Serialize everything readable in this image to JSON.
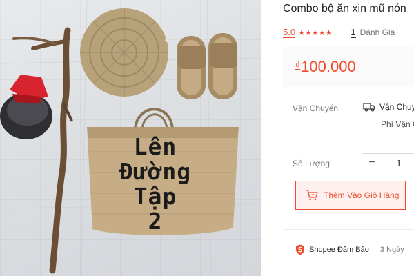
{
  "photo": {
    "bag_text_lines": [
      "Lên",
      "Đường",
      "Tập",
      "2"
    ]
  },
  "product": {
    "title": "Combo bộ ăn xin mũ nón",
    "rating_score": "5.0",
    "stars": "★★★★★",
    "review_count": "1",
    "review_label": "Đánh Giá",
    "currency_symbol": "₫",
    "price": "100.000"
  },
  "shipping": {
    "label": "Vận Chuyển",
    "value": "Vận Chuy",
    "sub": "Phí Vận C"
  },
  "quantity": {
    "label": "Số Lượng",
    "minus": "−",
    "value": "1",
    "plus": "+"
  },
  "actions": {
    "add_to_cart": "Thêm Vào Giỏ Hàng"
  },
  "guarantee": {
    "label": "Shopee Đảm Bảo",
    "days": "3 Ngày"
  },
  "colors": {
    "accent": "#ee4d2d",
    "cart_bg": "#fdf0ee",
    "price_bg": "#fafafa"
  }
}
